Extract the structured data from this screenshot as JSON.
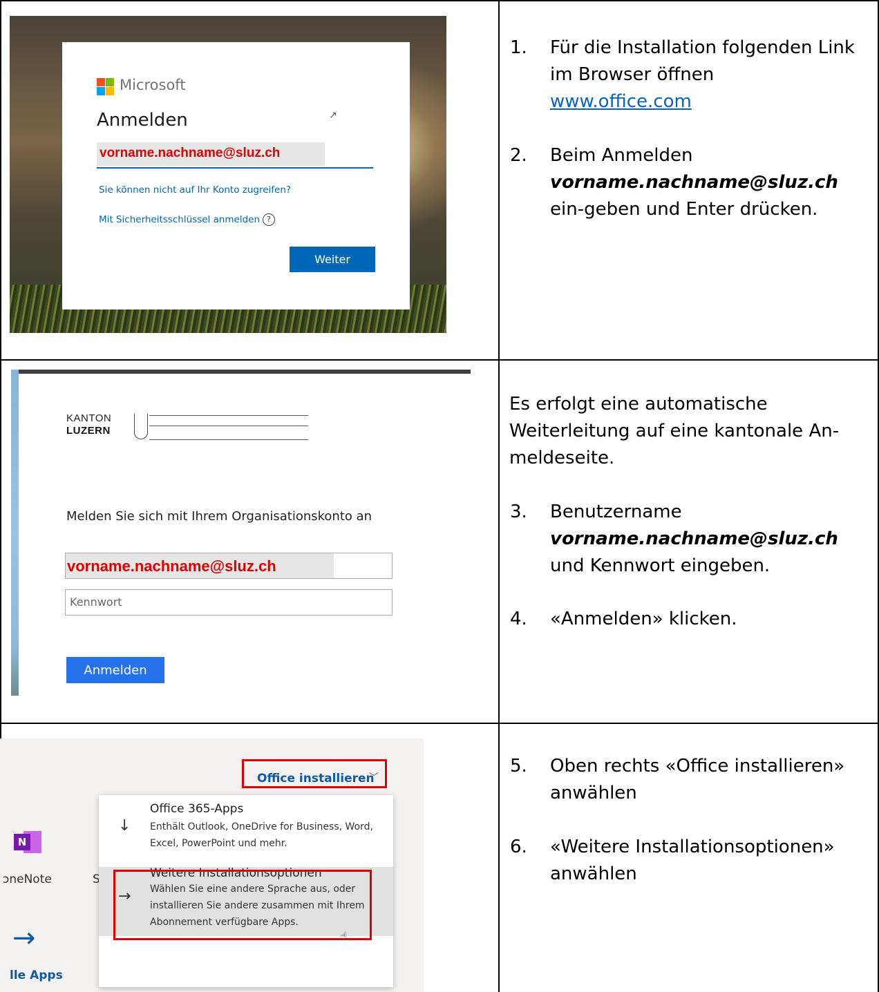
{
  "row1": {
    "ms_brand": "Microsoft",
    "ms_title": "Anmelden",
    "ms_email": "vorname.nachname@sluz.ch",
    "ms_link_account": "Sie können nicht auf Ihr Konto zugreifen?",
    "ms_link_key": "Mit Sicherheitsschlüssel anmelden",
    "ms_help": "?",
    "ms_next": "Weiter",
    "step1_num": "1.",
    "step1_text": "Für die Installation folgenden Link im Browser öffnen",
    "step1_link": "www.office.com",
    "step2_num": "2.",
    "step2_text_a": "Beim Anmelden",
    "step2_email": "vorname.nachname@sluz.ch",
    "step2_text_b": " ein-geben und Enter drücken."
  },
  "row2": {
    "logo_kanton": "KANTON",
    "logo_luzern": "LUZERN",
    "org_prompt": "Melden Sie sich mit Ihrem Organisationskonto an",
    "org_email": "vorname.nachname@sluz.ch",
    "org_password_placeholder": "Kennwort",
    "org_signin": "Anmelden",
    "redirect_text": "Es erfolgt eine automatische Weiterleitung auf eine kantonale An-meldeseite.",
    "step3_num": "3.",
    "step3_text_a": "Benutzername",
    "step3_email": "vorname.nachname@sluz.ch",
    "step3_text_b": " und Kennwort eingeben.",
    "step4_num": "4.",
    "step4_text": "«Anmelden» klicken."
  },
  "row3": {
    "install_button": "Office installieren",
    "chevron": "﹀",
    "item1_title": "Office 365-Apps",
    "item1_desc": "Enthält Outlook, OneDrive for Business, Word, Excel, PowerPoint und mehr.",
    "item2_title": "Weitere Installationsoptionen",
    "item2_desc": "Wählen Sie eine andere Sprache aus, oder installieren Sie andere zusammen mit Ihrem Abonnement verfügbare Apps.",
    "onenote_letter": "N",
    "onenote_label": "ɔneNote",
    "s_fragment": "S",
    "all_apps": "lle Apps",
    "step5_num": "5.",
    "step5_text": "Oben rechts «Office installieren» anwählen",
    "step6_num": "6.",
    "step6_text": "«Weitere Installationsoptionen» anwählen"
  },
  "colors": {
    "ms_blue": "#0067b8",
    "highlight_red": "#e00000",
    "link_blue": "#0563c1",
    "onenote_purple": "#7719aa"
  }
}
